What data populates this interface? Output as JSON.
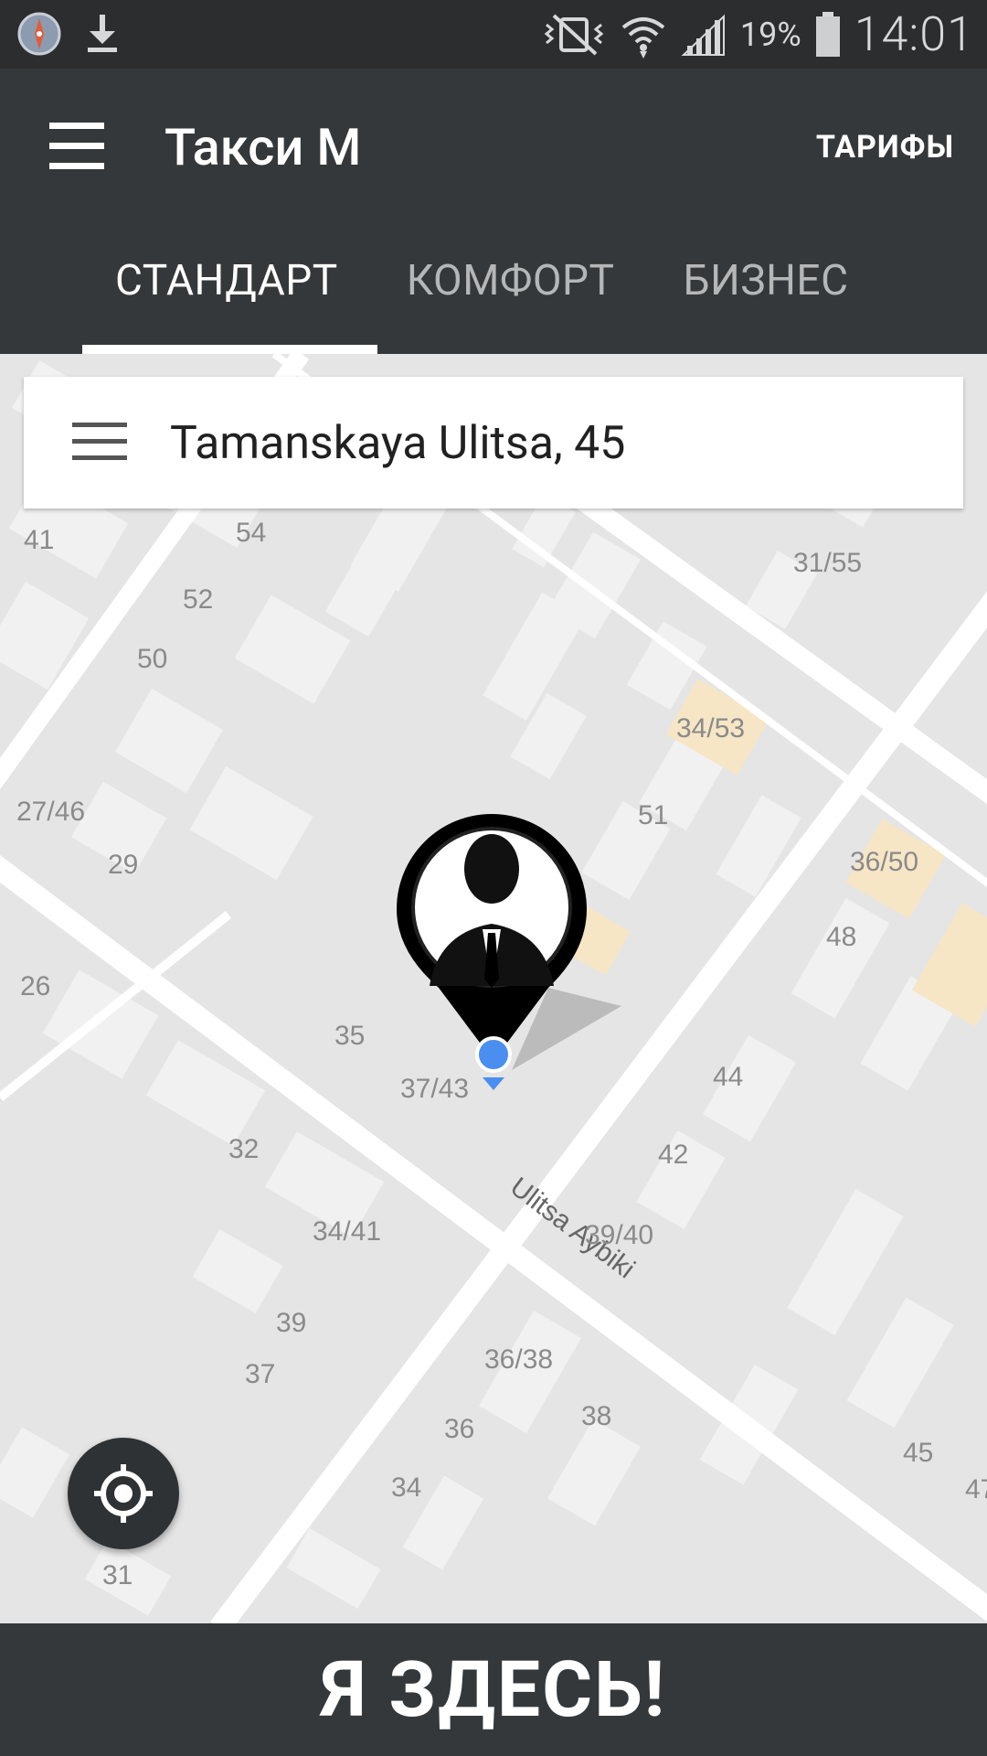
{
  "status_bar": {
    "battery_percent": "19%",
    "time": "14:01"
  },
  "app_bar": {
    "title": "Такси М",
    "tariffs_button": "ТАРИФЫ"
  },
  "tabs": [
    {
      "label": "СТАНДАРТ",
      "active": true
    },
    {
      "label": "КОМФОРТ",
      "active": false
    },
    {
      "label": "БИЗНЕС",
      "active": false
    }
  ],
  "search": {
    "address": "Tamanskaya Ulitsa, 45"
  },
  "map": {
    "street_name": "Ulitsa Aybiki",
    "house_numbers": [
      "41",
      "54",
      "52",
      "50",
      "31/55",
      "34/53",
      "27/46",
      "29",
      "51",
      "36/50",
      "48",
      "26",
      "35",
      "37/43",
      "44",
      "32",
      "42",
      "34/41",
      "39/40",
      "39",
      "37",
      "36/38",
      "38",
      "36",
      "45",
      "47",
      "34",
      "31"
    ]
  },
  "bottom_button": {
    "label": "Я ЗДЕСЬ!"
  }
}
